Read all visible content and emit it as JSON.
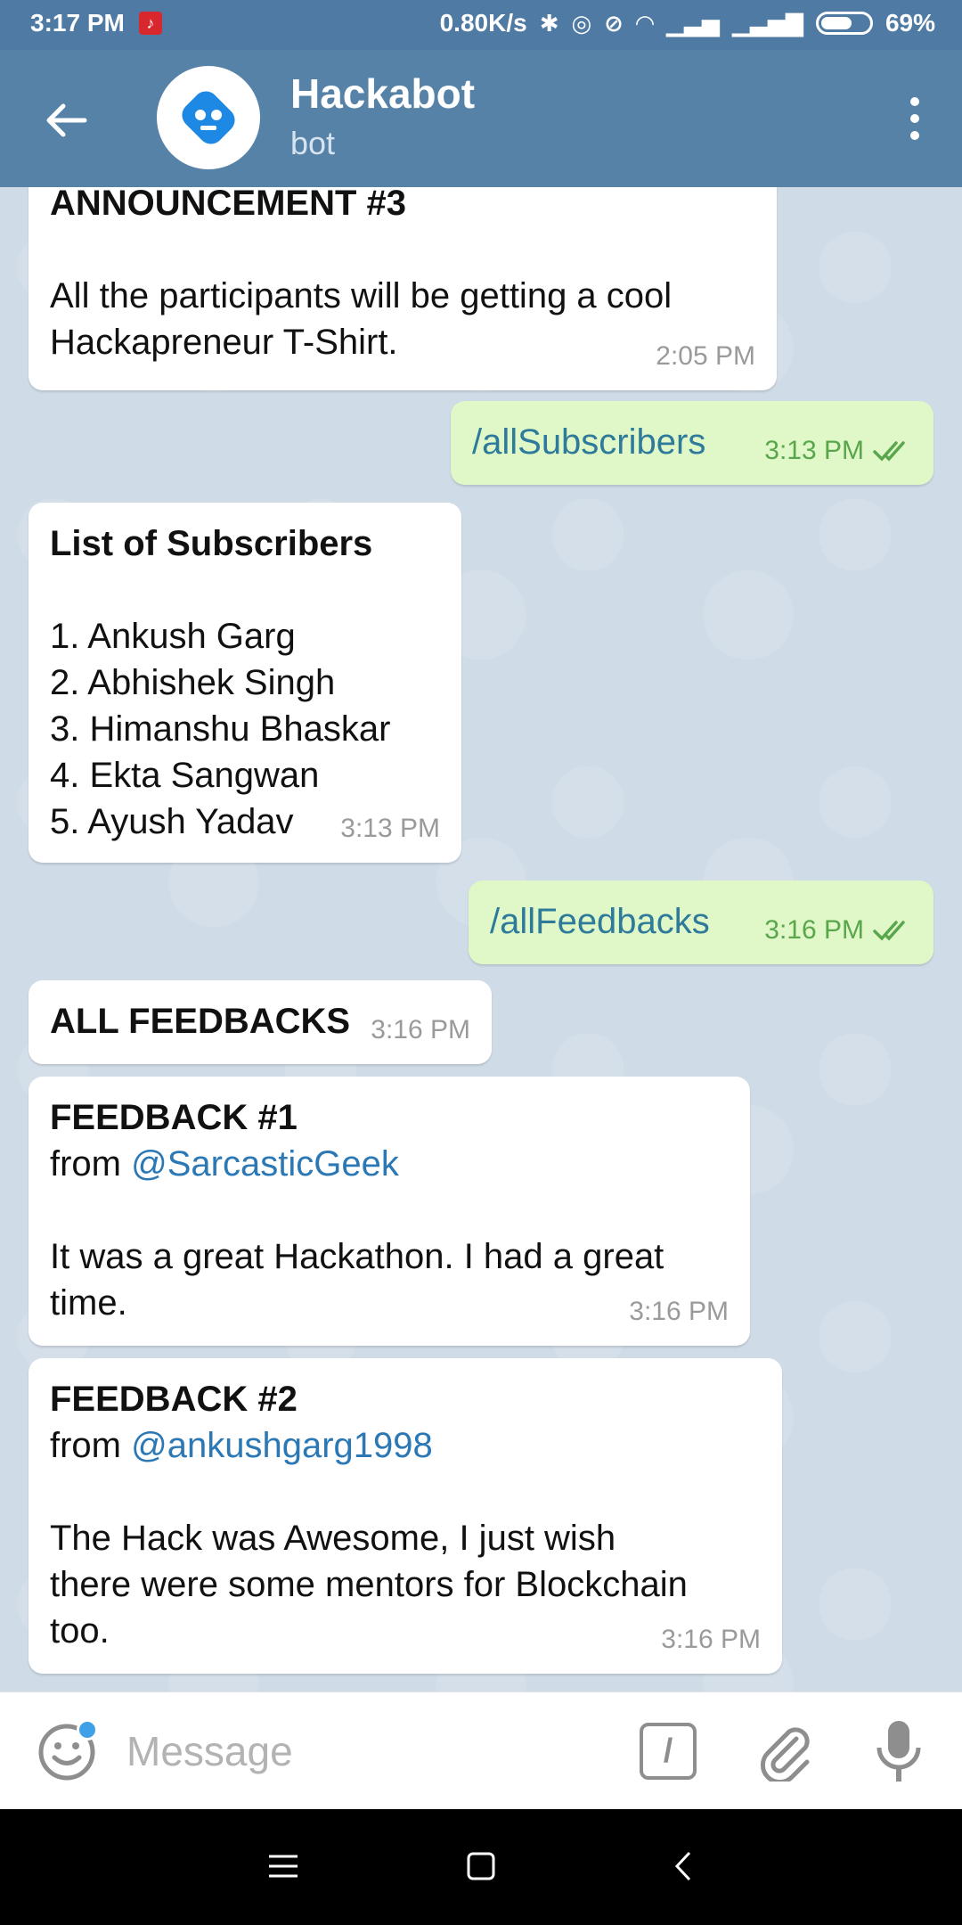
{
  "status_bar": {
    "time": "3:17 PM",
    "network_speed": "0.80K/s",
    "battery": "69%",
    "battery_level": 0.69
  },
  "header": {
    "title": "Hackabot",
    "subtitle": "bot"
  },
  "messages": [
    {
      "direction": "in",
      "lines": [
        "ANNOUNCEMENT #3",
        "",
        "All the participants will be getting a cool",
        "Hackapreneur T-Shirt."
      ],
      "time": "2:05 PM"
    },
    {
      "direction": "out",
      "text": "/allSubscribers",
      "time": "3:13 PM",
      "status": "read"
    },
    {
      "direction": "in",
      "lines": [
        "List of Subscribers",
        "",
        "1. Ankush Garg",
        "2. Abhishek Singh",
        "3. Himanshu Bhaskar",
        "4. Ekta Sangwan",
        "5. Ayush Yadav"
      ],
      "time": "3:13 PM"
    },
    {
      "direction": "out",
      "text": "/allFeedbacks",
      "time": "3:16 PM",
      "status": "read"
    },
    {
      "direction": "in",
      "lines": [
        "ALL FEEDBACKS"
      ],
      "time": "3:16 PM"
    },
    {
      "direction": "in",
      "lines": [
        "FEEDBACK #1",
        "from ",
        "",
        "It was a great Hackathon. I had a great",
        "time."
      ],
      "mention": "@SarcasticGeek",
      "time": "3:16 PM"
    },
    {
      "direction": "in",
      "lines": [
        "FEEDBACK #2",
        "from ",
        "",
        "The Hack was Awesome, I just wish",
        "there were some mentors for Blockchain",
        "too."
      ],
      "mention": "@ankushgarg1998",
      "time": "3:16 PM"
    }
  ],
  "input": {
    "placeholder": "Message"
  },
  "colors": {
    "app_bar": "#5682a8",
    "status_bar": "#4f7aa3",
    "outgoing_bubble": "#e0f8c8",
    "link": "#2b78b5",
    "read_check": "#5aa64d"
  },
  "icons": {
    "back": "arrow-left-icon",
    "menu": "more-vertical-icon",
    "emoji": "smile-icon",
    "commands": "slash-command-icon",
    "attach": "paperclip-icon",
    "mic": "microphone-icon",
    "nav_menu": "menu-icon",
    "nav_home": "home-square-icon",
    "nav_back": "chevron-left-icon"
  }
}
